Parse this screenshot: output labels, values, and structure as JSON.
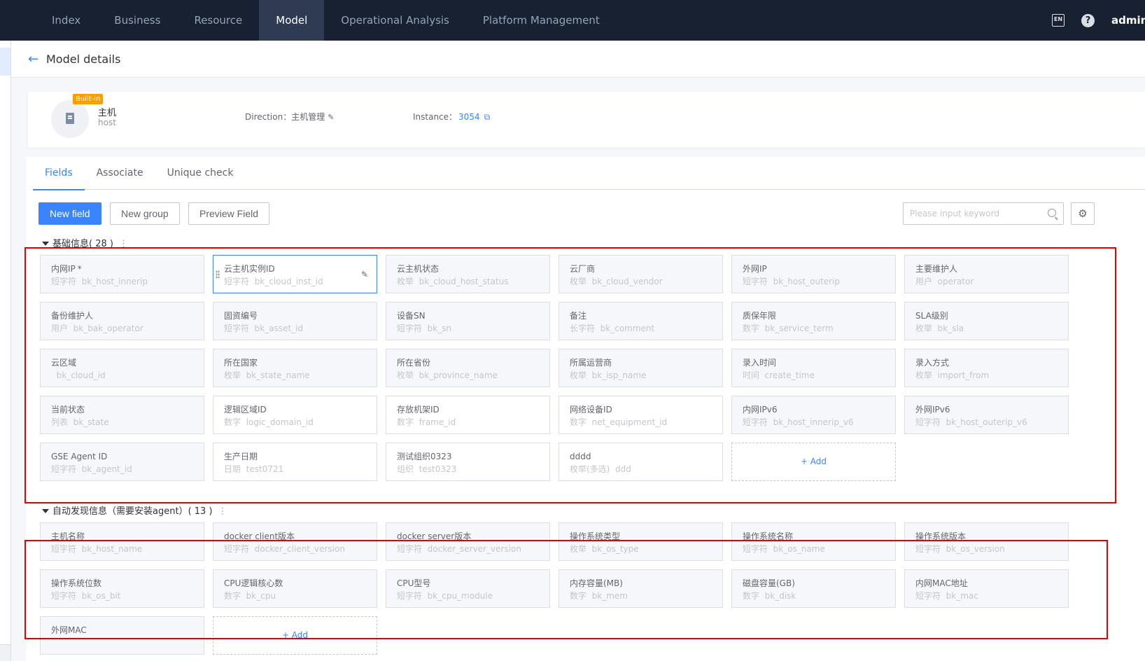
{
  "nav": {
    "items": [
      "Index",
      "Business",
      "Resource",
      "Model",
      "Operational Analysis",
      "Platform Management"
    ],
    "active_index": 3,
    "lang_label": "EN",
    "user": "admin"
  },
  "page": {
    "title": "Model details"
  },
  "model": {
    "badge": "Built-in",
    "name": "主机",
    "id": "host",
    "direction_label": "Direction：",
    "direction_value": "主机管理",
    "instance_label": "Instance：",
    "instance_count": "3054"
  },
  "tabs": [
    "Fields",
    "Associate",
    "Unique check"
  ],
  "toolbar": {
    "new_field": "New field",
    "new_group": "New group",
    "preview_field": "Preview Field",
    "search_placeholder": "Please input keyword"
  },
  "groups": [
    {
      "title": "基础信息",
      "count": "( 28 )",
      "fields": [
        {
          "name": "内网IP",
          "required": true,
          "type": "短字符",
          "id": "bk_host_innerip",
          "builtin": true
        },
        {
          "name": "云主机实例ID",
          "type": "短字符",
          "id": "bk_cloud_inst_id",
          "builtin": true,
          "hover": true
        },
        {
          "name": "云主机状态",
          "type": "枚举",
          "id": "bk_cloud_host_status",
          "builtin": true
        },
        {
          "name": "云厂商",
          "type": "枚举",
          "id": "bk_cloud_vendor",
          "builtin": true
        },
        {
          "name": "外网IP",
          "type": "短字符",
          "id": "bk_host_outerip",
          "builtin": true
        },
        {
          "name": "主要维护人",
          "type": "用户",
          "id": "operator",
          "builtin": true
        },
        {
          "name": "备份维护人",
          "type": "用户",
          "id": "bk_bak_operator",
          "builtin": true
        },
        {
          "name": "固资编号",
          "type": "短字符",
          "id": "bk_asset_id",
          "builtin": true
        },
        {
          "name": "设备SN",
          "type": "短字符",
          "id": "bk_sn",
          "builtin": true
        },
        {
          "name": "备注",
          "type": "长字符",
          "id": "bk_comment",
          "builtin": true
        },
        {
          "name": "质保年限",
          "type": "数字",
          "id": "bk_service_term",
          "builtin": true
        },
        {
          "name": "SLA级别",
          "type": "枚举",
          "id": "bk_sla",
          "builtin": true
        },
        {
          "name": "云区域",
          "type": "",
          "id": "bk_cloud_id",
          "builtin": true
        },
        {
          "name": "所在国家",
          "type": "枚举",
          "id": "bk_state_name",
          "builtin": true
        },
        {
          "name": "所在省份",
          "type": "枚举",
          "id": "bk_province_name",
          "builtin": true
        },
        {
          "name": "所属运营商",
          "type": "枚举",
          "id": "bk_isp_name",
          "builtin": true
        },
        {
          "name": "录入时间",
          "type": "时间",
          "id": "create_time",
          "builtin": true
        },
        {
          "name": "录入方式",
          "type": "枚举",
          "id": "import_from",
          "builtin": true
        },
        {
          "name": "当前状态",
          "type": "列表",
          "id": "bk_state",
          "builtin": true
        },
        {
          "name": "逻辑区域ID",
          "type": "数字",
          "id": "logic_domain_id",
          "builtin": false
        },
        {
          "name": "存放机架ID",
          "type": "数字",
          "id": "frame_id",
          "builtin": false
        },
        {
          "name": "网络设备ID",
          "type": "数字",
          "id": "net_equipment_id",
          "builtin": false
        },
        {
          "name": "内网IPv6",
          "type": "短字符",
          "id": "bk_host_innerip_v6",
          "builtin": true
        },
        {
          "name": "外网IPv6",
          "type": "短字符",
          "id": "bk_host_outerip_v6",
          "builtin": true
        },
        {
          "name": "GSE Agent ID",
          "type": "短字符",
          "id": "bk_agent_id",
          "builtin": true
        },
        {
          "name": "生产日期",
          "type": "日期",
          "id": "test0721",
          "builtin": false
        },
        {
          "name": "测试组织0323",
          "type": "组织",
          "id": "test0323",
          "builtin": false
        },
        {
          "name": "dddd",
          "type": "枚举(多选)",
          "id": "ddd",
          "builtin": false
        }
      ],
      "add_label": "+ Add"
    },
    {
      "title": "自动发现信息（需要安装agent）",
      "count": "( 13 )",
      "fields": [
        {
          "name": "主机名称",
          "type": "短字符",
          "id": "bk_host_name",
          "builtin": true
        },
        {
          "name": "docker client版本",
          "type": "短字符",
          "id": "docker_client_version",
          "builtin": true
        },
        {
          "name": "docker server版本",
          "type": "短字符",
          "id": "docker_server_version",
          "builtin": true
        },
        {
          "name": "操作系统类型",
          "type": "枚举",
          "id": "bk_os_type",
          "builtin": true
        },
        {
          "name": "操作系统名称",
          "type": "短字符",
          "id": "bk_os_name",
          "builtin": true
        },
        {
          "name": "操作系统版本",
          "type": "短字符",
          "id": "bk_os_version",
          "builtin": true
        },
        {
          "name": "操作系统位数",
          "type": "短字符",
          "id": "bk_os_bit",
          "builtin": true
        },
        {
          "name": "CPU逻辑核心数",
          "type": "数字",
          "id": "bk_cpu",
          "builtin": true
        },
        {
          "name": "CPU型号",
          "type": "短字符",
          "id": "bk_cpu_module",
          "builtin": true
        },
        {
          "name": "内存容量(MB)",
          "type": "数字",
          "id": "bk_mem",
          "builtin": true
        },
        {
          "name": "磁盘容量(GB)",
          "type": "数字",
          "id": "bk_disk",
          "builtin": true
        },
        {
          "name": "内网MAC地址",
          "type": "短字符",
          "id": "bk_mac",
          "builtin": true
        },
        {
          "name": "外网MAC",
          "type": "",
          "id": "",
          "builtin": true
        }
      ],
      "add_label": "+ Add"
    }
  ],
  "colors": {
    "accent": "#3a84ff",
    "nav_bg": "#182132",
    "badge": "#ff9c01",
    "highlight": "#e60000"
  }
}
